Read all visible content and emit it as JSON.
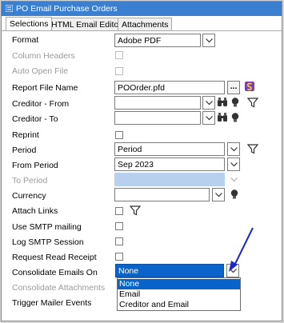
{
  "window": {
    "title": "PO Email Purchase Orders"
  },
  "tabs": [
    {
      "label": "Selections"
    },
    {
      "label": "HTML Email Editor"
    },
    {
      "label": "Attachments"
    }
  ],
  "form": {
    "format": {
      "label": "Format",
      "value": "Adobe PDF"
    },
    "column_headers": {
      "label": "Column Headers"
    },
    "auto_open_file": {
      "label": "Auto Open File"
    },
    "report_file_name": {
      "label": "Report File Name",
      "value": "POOrder.pfd",
      "browse_label": "..."
    },
    "creditor_from": {
      "label": "Creditor - From",
      "value": ""
    },
    "creditor_to": {
      "label": "Creditor - To",
      "value": ""
    },
    "reprint": {
      "label": "Reprint"
    },
    "period": {
      "label": "Period",
      "value": "Period"
    },
    "from_period": {
      "label": "From Period",
      "value": "Sep 2023"
    },
    "to_period": {
      "label": "To Period",
      "value": ""
    },
    "currency": {
      "label": "Currency",
      "value": ""
    },
    "attach_links": {
      "label": "Attach Links"
    },
    "use_smtp": {
      "label": "Use SMTP mailing"
    },
    "log_smtp": {
      "label": "Log SMTP Session"
    },
    "request_read_receipt": {
      "label": "Request Read Receipt"
    },
    "consolidate_emails_on": {
      "label": "Consolidate Emails On",
      "value": "None",
      "options": [
        "None",
        "Email",
        "Creditor and Email"
      ],
      "highlighted_option": "None"
    },
    "consolidate_attachments": {
      "label": "Consolidate Attachments"
    },
    "trigger_mailer_events": {
      "label": "Trigger Mailer Events"
    }
  },
  "colors": {
    "titlebar": "#3b7fd1",
    "selection": "#0a63c9",
    "disabled_field": "#b7d0ee",
    "annotation_arrow": "#1c28c8"
  },
  "icons": [
    "binoculars-icon",
    "lightbulb-icon",
    "filter-icon",
    "crystal-reports-icon",
    "chevron-down-icon"
  ]
}
